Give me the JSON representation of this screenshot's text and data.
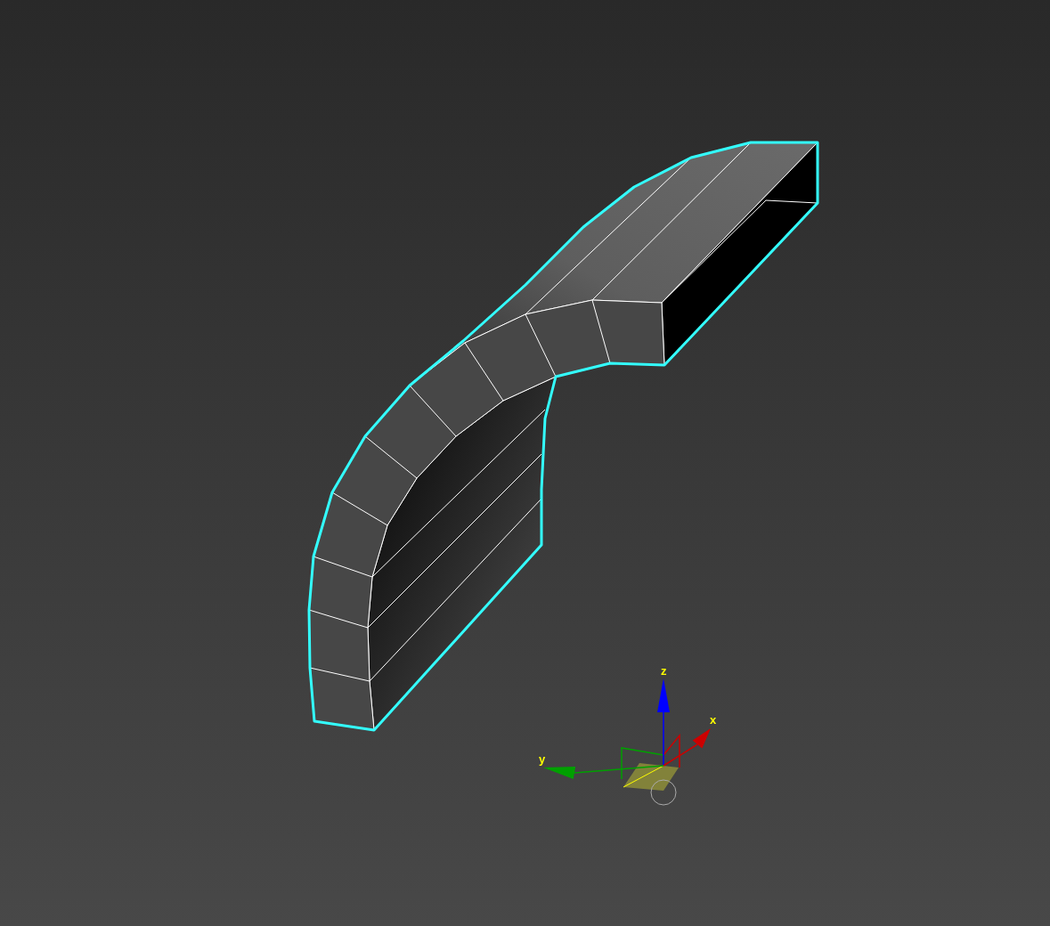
{
  "viewport": {
    "gizmo": {
      "axes": [
        {
          "label": "z",
          "color": "#0000ff"
        },
        {
          "label": "x",
          "color": "#cc0000"
        },
        {
          "label": "y",
          "color": "#00a000"
        }
      ]
    }
  }
}
